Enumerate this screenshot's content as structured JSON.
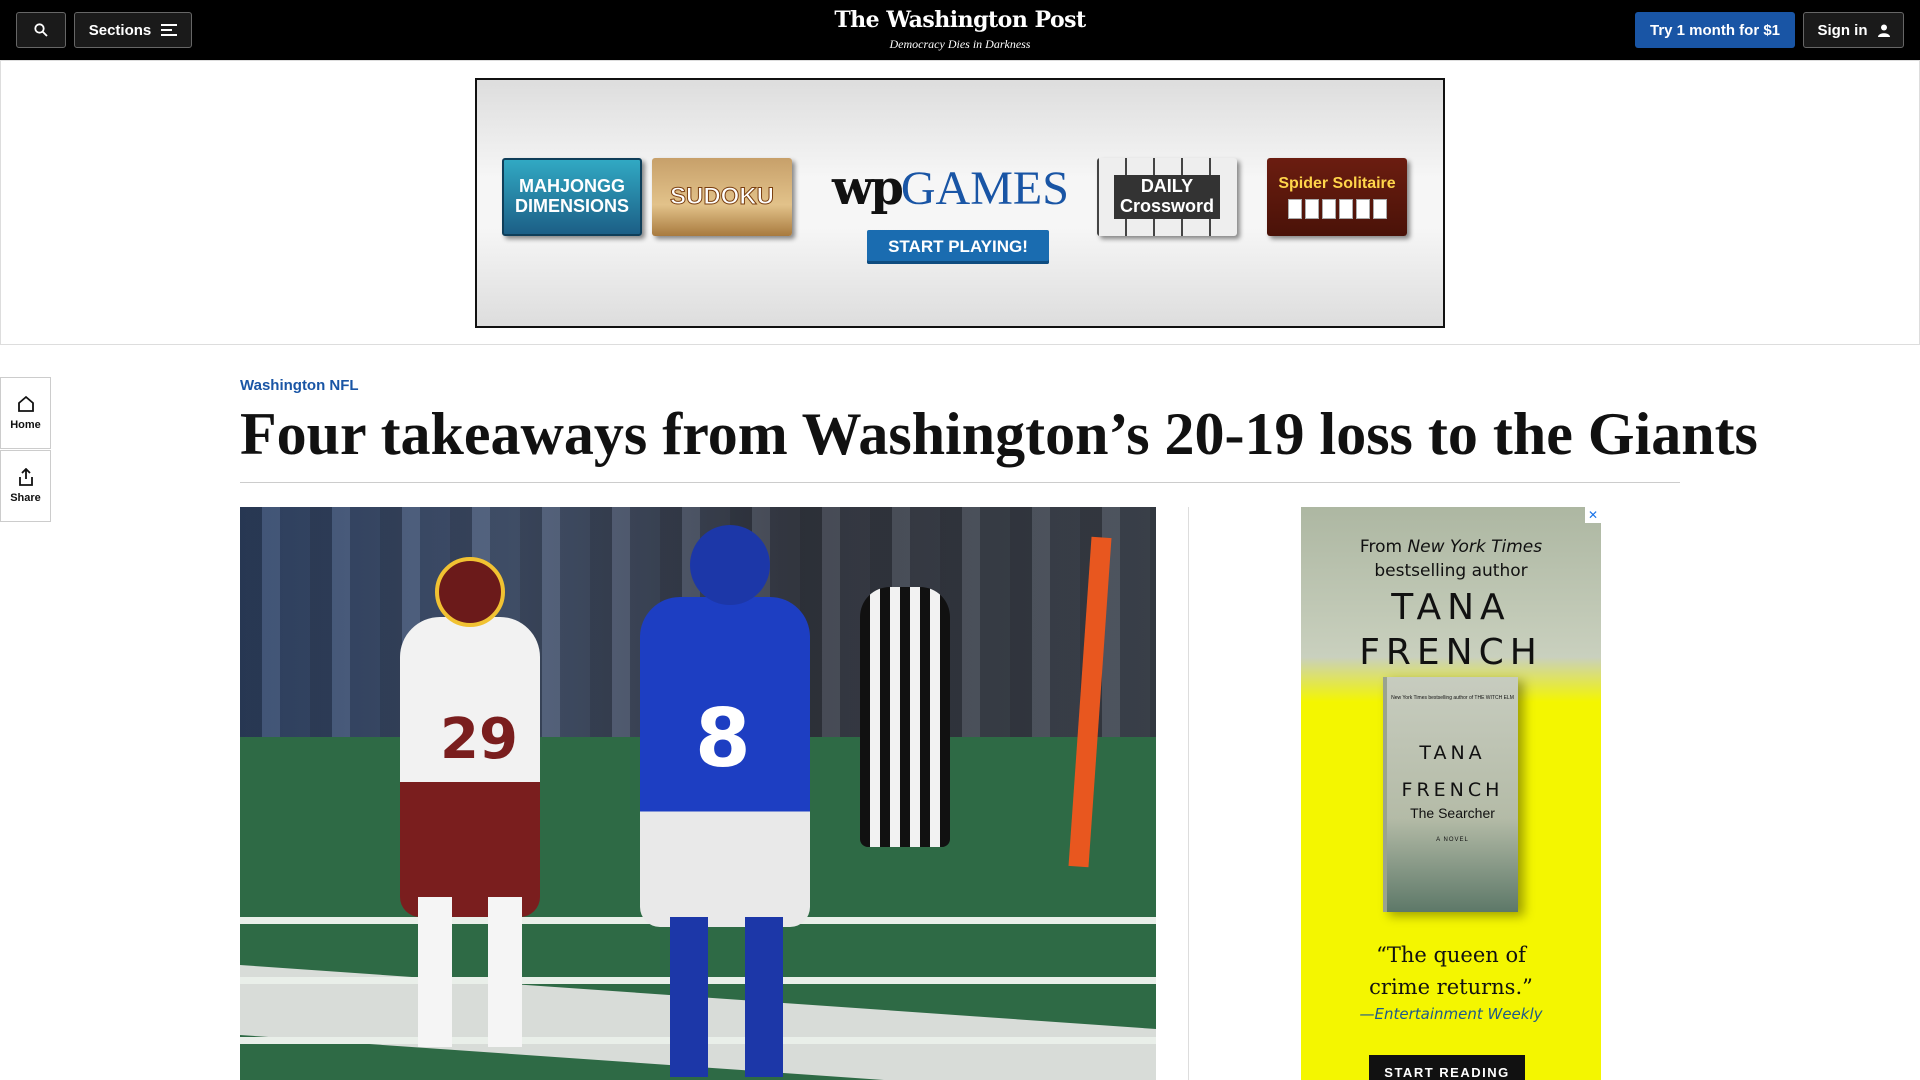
{
  "header": {
    "sections_label": "Sections",
    "logo_name": "The Washington Post",
    "logo_tagline": "Democracy Dies in Darkness",
    "trial_button": "Try 1 month for $1",
    "signin_button": "Sign in",
    "icons": {
      "search": "search-icon",
      "menu": "menu-icon",
      "user": "user-icon"
    }
  },
  "top_ad": {
    "brand": "wp",
    "brand_word": "GAMES",
    "cta": "START PLAYING!",
    "tiles": {
      "mahjong": "MAHJONGG DIMENSIONS",
      "sudoku": "SUDOKU",
      "crossword_1": "DAILY",
      "crossword_2": "Crossword",
      "spider": "Spider Solitaire"
    }
  },
  "rail": {
    "home": "Home",
    "share": "Share",
    "icons": {
      "home": "home-icon",
      "share": "share-icon"
    }
  },
  "article": {
    "kicker": "Washington NFL",
    "headline": "Four takeaways from Washington’s 20-19 loss to the Giants"
  },
  "side_ad": {
    "from_prefix": "From",
    "from_pub": "New York Times",
    "from_suffix": "bestselling author",
    "author_first": "TANA",
    "author_last": "FRENCH",
    "book_first": "TANA",
    "book_last": "FRENCH",
    "book_title": "The Searcher",
    "book_novel": "A NOVEL",
    "book_small": "New York Times bestselling author of THE WITCH ELM",
    "quote_line1": "“The queen of",
    "quote_line2": "crime returns.”",
    "source": "—Entertainment Weekly",
    "cta": "START READING",
    "close_label": "✕",
    "colors": {
      "background": "#f4f600",
      "link": "#1e5a8a"
    }
  },
  "colors": {
    "brand_blue": "#1955a5",
    "topbar": "#000000"
  }
}
